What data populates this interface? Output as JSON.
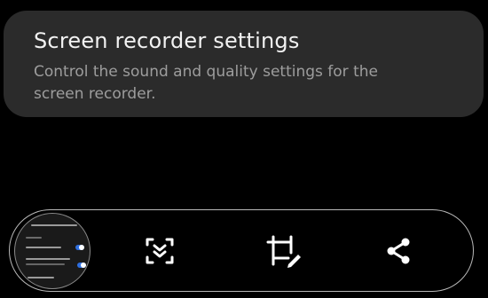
{
  "settings_card": {
    "title": "Screen recorder settings",
    "description": "Control the sound and quality settings for the screen recorder."
  },
  "toolbar": {
    "thumbnail": "screenshot-thumbnail",
    "buttons": [
      {
        "name": "scroll-capture-button",
        "icon": "scroll-capture-icon"
      },
      {
        "name": "crop-edit-button",
        "icon": "crop-edit-icon"
      },
      {
        "name": "share-button",
        "icon": "share-icon"
      }
    ]
  },
  "colors": {
    "background": "#000000",
    "card": "#2b2b2b",
    "title": "#f2f2f2",
    "description": "#9d9d9d",
    "toolbar_border": "#b9b9b9",
    "icon": "#ffffff"
  }
}
